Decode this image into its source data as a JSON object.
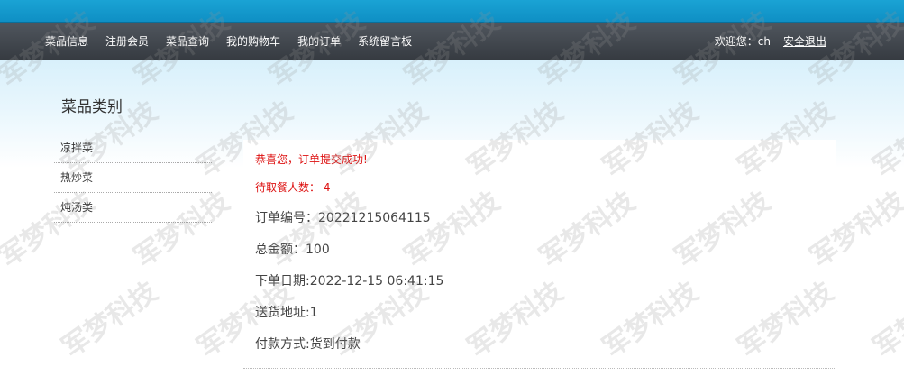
{
  "nav": {
    "items": [
      "菜品信息",
      "注册会员",
      "菜品查询",
      "我的购物车",
      "我的订单",
      "系统留言板"
    ],
    "welcome": "欢迎您：ch",
    "logout": "安全退出"
  },
  "sidebar": {
    "title": "菜品类别",
    "items": [
      "凉拌菜",
      "热炒菜",
      "炖汤类"
    ]
  },
  "order": {
    "success_msg": "恭喜您，订单提交成功!",
    "pickup_count": "待取餐人数： 4",
    "order_no": "订单编号：20221215064115",
    "total": "总金额：100",
    "date": "下单日期:2022-12-15 06:41:15",
    "address": "送货地址:1",
    "payment": "付款方式:货到付款"
  },
  "watermark": {
    "text": "军梦科技"
  }
}
